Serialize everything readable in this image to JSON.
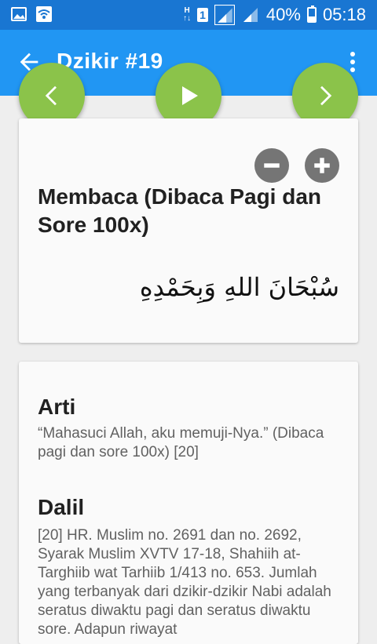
{
  "status_bar": {
    "network_badge": "H",
    "sim_label": "1",
    "battery": "40%",
    "battery_level": 0.4,
    "time": "05:18"
  },
  "app_bar": {
    "title": "Dzikir #19"
  },
  "card_main": {
    "heading": "Membaca (Dibaca Pagi dan Sore 100x)",
    "arabic": "سُبْحَانَ اللهِ وَبِحَمْدِهِ"
  },
  "card_detail": {
    "arti_title": "Arti",
    "arti_text": "“Mahasuci Allah, aku memuji-Nya.” (Dibaca pagi dan sore 100x) [20]",
    "dalil_title": "Dalil",
    "dalil_text": "[20] HR. Muslim no. 2691 dan no. 2692, Syarak Muslim XVTV 17-18, Shahiih at-Targhiib wat Tarhiib 1/413 no. 653. Jumlah yang terbanyak dari dzikir-dzikir Nabi adalah seratus diwaktu pagi dan seratus diwaktu sore. Adapun riwayat"
  },
  "colors": {
    "status_bar": "#1976D2",
    "app_bar": "#2196F3",
    "fab": "#8BC34A",
    "zoom_button": "#757575"
  },
  "icons": {
    "back": "arrow-left-icon",
    "menu": "more-vert-icon",
    "prev": "chevron-left-icon",
    "play": "play-icon",
    "next": "chevron-right-icon",
    "zoom_out": "minus-circle-icon",
    "zoom_in": "plus-circle-icon"
  }
}
